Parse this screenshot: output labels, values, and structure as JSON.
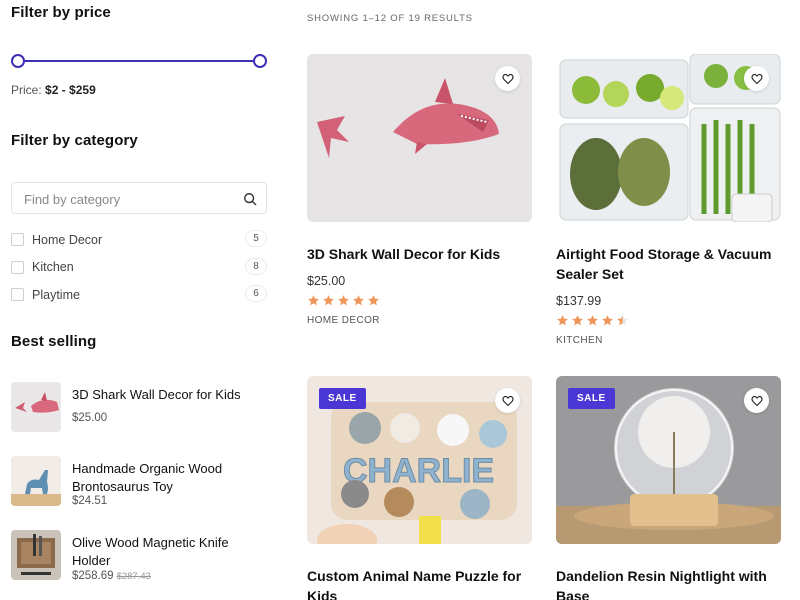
{
  "filters": {
    "price": {
      "title": "Filter by price",
      "readout_prefix": "Price:",
      "readout_range": "$2 - $259"
    },
    "category": {
      "title": "Filter by category",
      "search_placeholder": "Find by category",
      "items": [
        {
          "label": "Home Decor",
          "count": "5"
        },
        {
          "label": "Kitchen",
          "count": "8"
        },
        {
          "label": "Playtime",
          "count": "6"
        }
      ]
    }
  },
  "best_selling": {
    "title": "Best selling",
    "items": [
      {
        "name": "3D Shark Wall Decor for Kids",
        "price": "$25.00",
        "old_price": ""
      },
      {
        "name": "Handmade Organic Wood Brontosaurus Toy",
        "price": "$24.51",
        "old_price": ""
      },
      {
        "name": "Olive Wood Magnetic Knife Holder",
        "price": "$258.69",
        "old_price": "$287.43"
      }
    ]
  },
  "results_text": "SHOWING 1–12 OF 19 RESULTS",
  "products": [
    {
      "name": "3D Shark Wall Decor for Kids",
      "price": "$25.00",
      "rating": 5,
      "category": "HOME DECOR",
      "sale": "",
      "thumb": "shark-wall-decor-photo"
    },
    {
      "name": "Airtight Food Storage & Vacuum Sealer Set",
      "price": "$137.99",
      "rating": 4.5,
      "category": "KITCHEN",
      "sale": "",
      "thumb": "food-storage-containers-photo"
    },
    {
      "name": "Custom Animal Name Puzzle for Kids",
      "price": "",
      "rating": 0,
      "category": "",
      "sale": "SALE",
      "thumb": "animal-name-puzzle-photo"
    },
    {
      "name": "Dandelion Resin Nightlight with Base",
      "price": "",
      "rating": 0,
      "category": "",
      "sale": "SALE",
      "thumb": "dandelion-nightlight-photo"
    }
  ],
  "colors": {
    "accent": "#3d2fb6",
    "sale_badge": "#4a37d6",
    "star": "#f0965a"
  },
  "icons": [
    "search-icon",
    "heart-icon",
    "star-icon"
  ]
}
